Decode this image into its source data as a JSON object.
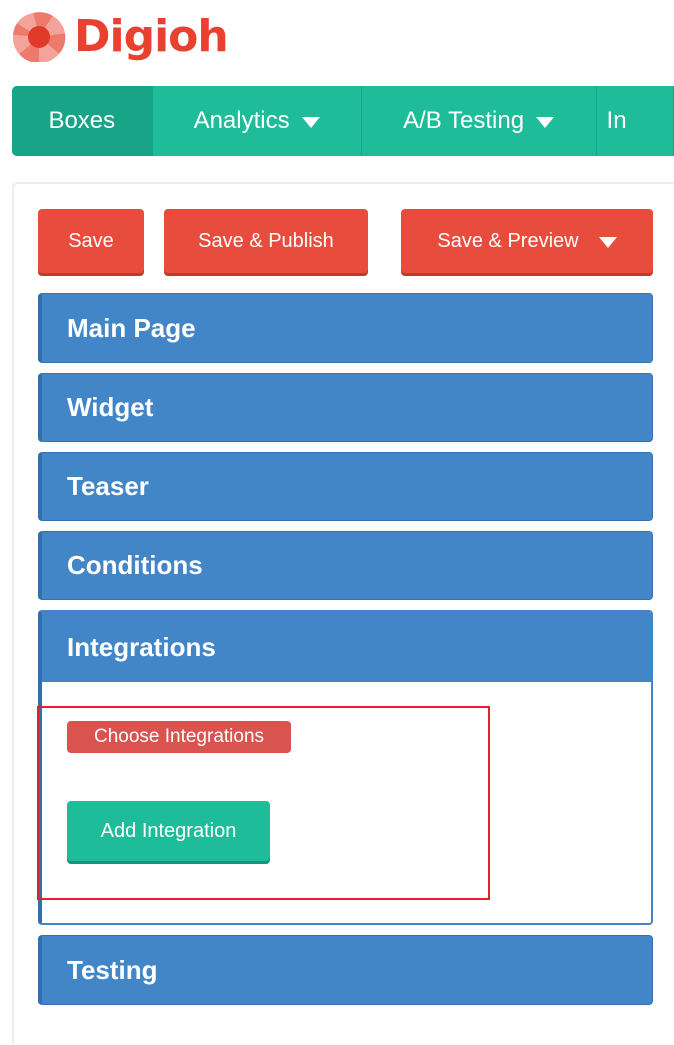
{
  "brand": {
    "name": "Digioh",
    "color": "#e8412f",
    "icon": "digioh-pinwheel-icon"
  },
  "nav": {
    "items": [
      {
        "label": "Boxes",
        "active": true
      },
      {
        "label": "Analytics",
        "dropdown": true
      },
      {
        "label": "A/B Testing",
        "dropdown": true
      },
      {
        "label": "In"
      }
    ],
    "color": "#1fbc9a"
  },
  "toolbar": {
    "save_label": "Save",
    "save_publish_label": "Save & Publish",
    "save_preview_label": "Save & Preview",
    "color": "#e84c3c"
  },
  "sections": {
    "main_page": "Main Page",
    "widget": "Widget",
    "teaser": "Teaser",
    "conditions": "Conditions",
    "integrations": "Integrations",
    "testing": "Testing",
    "header_color": "#4286c8"
  },
  "integrations": {
    "choose_label": "Choose Integrations",
    "add_button_label": "Add Integration"
  }
}
